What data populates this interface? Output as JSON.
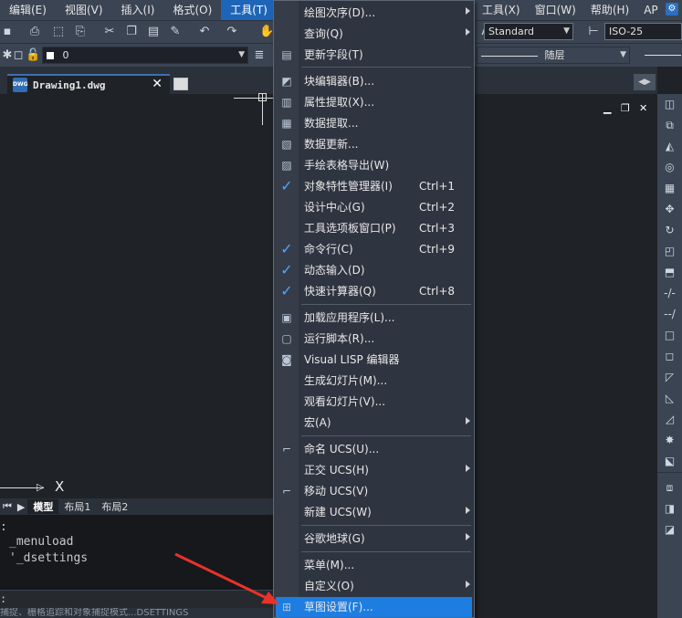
{
  "menubar": {
    "left": [
      {
        "label": "编辑(E)"
      },
      {
        "label": "视图(V)"
      },
      {
        "label": "插入(I)"
      },
      {
        "label": "格式(O)"
      },
      {
        "label": "工具(T)"
      }
    ],
    "right": [
      {
        "label": "工具(X)"
      },
      {
        "label": "窗口(W)"
      },
      {
        "label": "帮助(H)"
      },
      {
        "label": "AP"
      }
    ]
  },
  "toolbar": {
    "text_style": "Standard",
    "dim_style": "ISO-25",
    "layer_value": "0",
    "linetype": "随层"
  },
  "document": {
    "tab_title": "Drawing1.dwg",
    "file_badge": "DWG",
    "axis_x_label": "X"
  },
  "layouts": {
    "tabs": [
      "模型",
      "布局1",
      "布局2"
    ]
  },
  "command": {
    "line1": "_menuload",
    "line2": "'_dsettings"
  },
  "status_text": "捕捉、栅格追踪和对象捕捉模式...DSETTINGS",
  "tools_menu": {
    "items": [
      {
        "label": "绘图次序(D)...",
        "submenu": true
      },
      {
        "label": "查询(Q)",
        "submenu": true
      },
      {
        "label": "更新字段(T)"
      },
      {
        "label": "块编辑器(B)..."
      },
      {
        "label": "属性提取(X)..."
      },
      {
        "label": "数据提取..."
      },
      {
        "label": "数据更新..."
      },
      {
        "label": "手绘表格导出(W)"
      },
      {
        "label": "对象特性管理器(I)",
        "shortcut": "Ctrl+1",
        "checked": true
      },
      {
        "label": "设计中心(G)",
        "shortcut": "Ctrl+2"
      },
      {
        "label": "工具选项板窗口(P)",
        "shortcut": "Ctrl+3"
      },
      {
        "label": "命令行(C)",
        "shortcut": "Ctrl+9",
        "checked": true
      },
      {
        "label": "动态输入(D)",
        "checked": true
      },
      {
        "label": "快速计算器(Q)",
        "shortcut": "Ctrl+8",
        "checked": true
      },
      {
        "label": "加载应用程序(L)..."
      },
      {
        "label": "运行脚本(R)..."
      },
      {
        "label": "Visual LISP 编辑器"
      },
      {
        "label": "生成幻灯片(M)..."
      },
      {
        "label": "观看幻灯片(V)..."
      },
      {
        "label": "宏(A)",
        "submenu": true
      },
      {
        "label": "命名 UCS(U)..."
      },
      {
        "label": "正交 UCS(H)",
        "submenu": true
      },
      {
        "label": "移动 UCS(V)"
      },
      {
        "label": "新建 UCS(W)",
        "submenu": true
      },
      {
        "label": "谷歌地球(G)",
        "submenu": true
      },
      {
        "label": "菜单(M)..."
      },
      {
        "label": "自定义(O)",
        "submenu": true
      },
      {
        "label": "草图设置(F)...",
        "highlighted": true
      }
    ]
  },
  "colors": {
    "highlight": "#1e7de0",
    "menubar_active": "#1e65b8",
    "arrow": "#e8322a"
  }
}
